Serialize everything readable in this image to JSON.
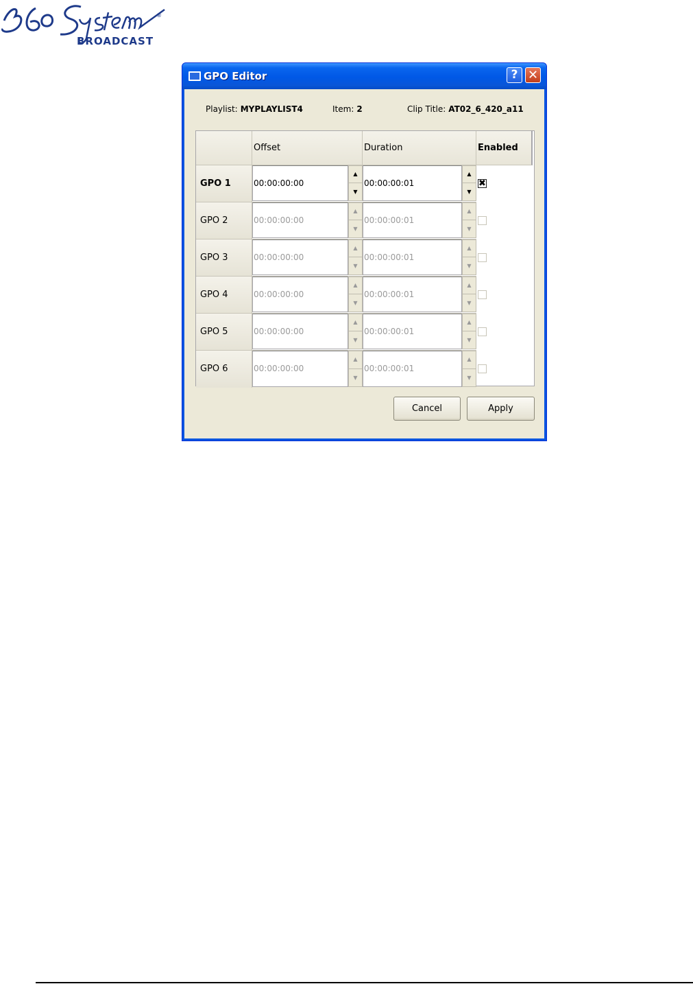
{
  "brand": {
    "logo_text": "360 Systems",
    "logo_sub": "BROADCAST",
    "logo_mark": "®",
    "colors": {
      "logo_blue": "#1e3a8a"
    }
  },
  "dialog": {
    "title": "GPO Editor",
    "help_label": "?",
    "close_label": "✕"
  },
  "info": {
    "playlist_label": "Playlist:",
    "playlist_value": "MYPLAYLIST4",
    "item_label": "Item:",
    "item_value": "2",
    "clip_label": "Clip Title:",
    "clip_value": "AT02_6_420_a11"
  },
  "grid": {
    "headers": {
      "offset": "Offset",
      "duration": "Duration",
      "enabled": "Enabled"
    },
    "rows": [
      {
        "label": "GPO 1",
        "offset": "00:00:00:00",
        "duration": "00:00:00:01",
        "enabled": true,
        "check": "✖"
      },
      {
        "label": "GPO 2",
        "offset": "00:00:00:00",
        "duration": "00:00:00:01",
        "enabled": false,
        "check": ""
      },
      {
        "label": "GPO 3",
        "offset": "00:00:00:00",
        "duration": "00:00:00:01",
        "enabled": false,
        "check": ""
      },
      {
        "label": "GPO 4",
        "offset": "00:00:00:00",
        "duration": "00:00:00:01",
        "enabled": false,
        "check": ""
      },
      {
        "label": "GPO 5",
        "offset": "00:00:00:00",
        "duration": "00:00:00:01",
        "enabled": false,
        "check": ""
      },
      {
        "label": "GPO 6",
        "offset": "00:00:00:00",
        "duration": "00:00:00:01",
        "enabled": false,
        "check": ""
      }
    ]
  },
  "buttons": {
    "cancel": "Cancel",
    "apply": "Apply"
  },
  "icons": {
    "spin_up": "▲",
    "spin_down": "▼"
  }
}
